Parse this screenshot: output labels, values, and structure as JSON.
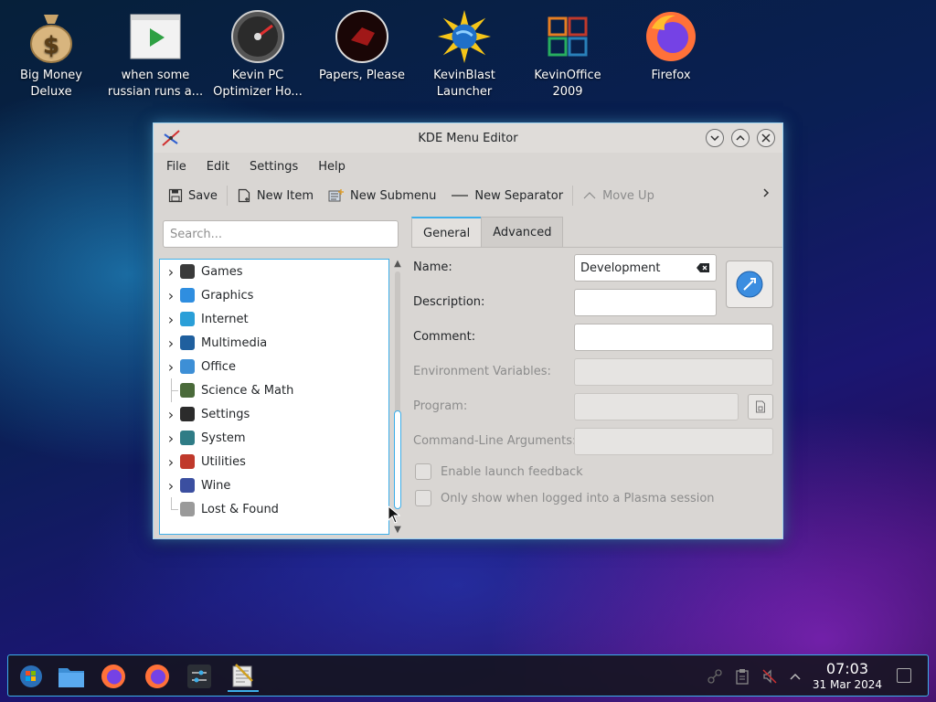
{
  "desktop": {
    "icons": [
      {
        "label": "Big Money Deluxe",
        "icon": "money-bag-icon"
      },
      {
        "label": "when some russian runs a...",
        "icon": "video-file-icon"
      },
      {
        "label": "Kevin PC Optimizer Ho...",
        "icon": "speedometer-icon"
      },
      {
        "label": "Papers, Please",
        "icon": "papers-please-icon"
      },
      {
        "label": "KevinBlast Launcher",
        "icon": "globe-sun-icon"
      },
      {
        "label": "KevinOffice 2009",
        "icon": "office-suite-icon"
      },
      {
        "label": "Firefox",
        "icon": "firefox-icon"
      }
    ]
  },
  "window": {
    "title": "KDE Menu Editor",
    "menu": [
      "File",
      "Edit",
      "Settings",
      "Help"
    ],
    "toolbar": {
      "save": "Save",
      "new_item": "New Item",
      "new_submenu": "New Submenu",
      "new_separator": "New Separator",
      "move_up": "Move Up"
    },
    "search_placeholder": "Search...",
    "tree": [
      {
        "label": "Games",
        "expandable": true,
        "color": "#3a3a3a"
      },
      {
        "label": "Graphics",
        "expandable": true,
        "color": "#2f8ee0"
      },
      {
        "label": "Internet",
        "expandable": true,
        "color": "#2a9fd8"
      },
      {
        "label": "Multimedia",
        "expandable": true,
        "color": "#1f5f9e"
      },
      {
        "label": "Office",
        "expandable": true,
        "color": "#3d8fd6"
      },
      {
        "label": "Science & Math",
        "expandable": false,
        "color": "#4a6a3a"
      },
      {
        "label": "Settings",
        "expandable": true,
        "color": "#2b2b2b"
      },
      {
        "label": "System",
        "expandable": true,
        "color": "#2f7c86"
      },
      {
        "label": "Utilities",
        "expandable": true,
        "color": "#c0392b"
      },
      {
        "label": "Wine",
        "expandable": true,
        "color": "#3b4fa0"
      },
      {
        "label": "Lost & Found",
        "expandable": false,
        "color": "#9a9a9a"
      }
    ],
    "tabs": [
      "General",
      "Advanced"
    ],
    "form": {
      "name_label": "Name:",
      "name_value": "Development",
      "description_label": "Description:",
      "comment_label": "Comment:",
      "env_label": "Environment Variables:",
      "program_label": "Program:",
      "args_label": "Command-Line Arguments:",
      "launch_feedback": "Enable launch feedback",
      "plasma_only": "Only show when logged into a Plasma session"
    }
  },
  "taskbar": {
    "time": "07:03",
    "date": "31 Mar 2024"
  },
  "colors": {
    "accent": "#3daee9",
    "window_bg": "#d9d6d3"
  }
}
